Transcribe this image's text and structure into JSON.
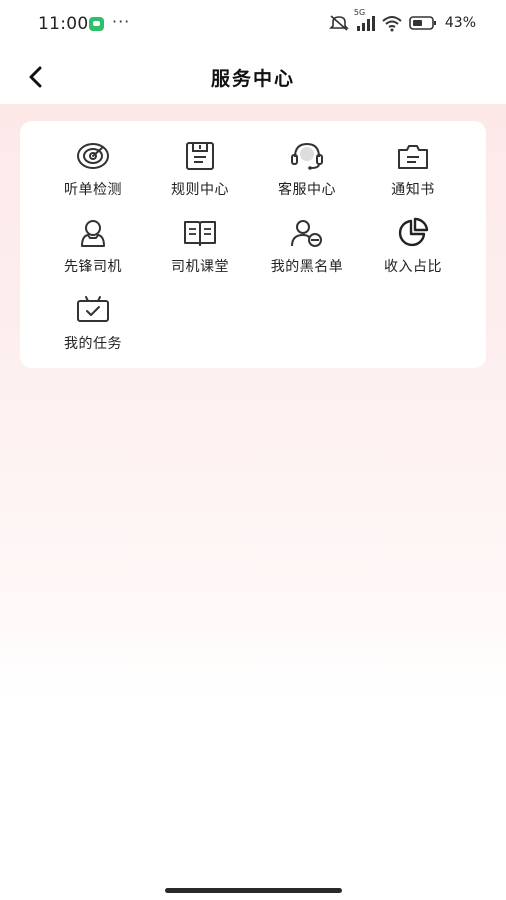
{
  "status_bar": {
    "time": "11:00",
    "more": "···",
    "network": "5G",
    "battery_pct": "43%"
  },
  "nav": {
    "title": "服务中心",
    "back_icon": "chevron-left-icon"
  },
  "services": [
    {
      "label": "听单检测",
      "icon": "radar-target-icon"
    },
    {
      "label": "规则中心",
      "icon": "save-document-icon"
    },
    {
      "label": "客服中心",
      "icon": "headset-icon"
    },
    {
      "label": "通知书",
      "icon": "notice-folder-icon"
    },
    {
      "label": "先锋司机",
      "icon": "driver-person-icon"
    },
    {
      "label": "司机课堂",
      "icon": "open-book-icon"
    },
    {
      "label": "我的黑名单",
      "icon": "blocked-user-icon"
    },
    {
      "label": "收入占比",
      "icon": "pie-chart-icon"
    },
    {
      "label": "我的任务",
      "icon": "task-tv-check-icon"
    }
  ],
  "colors": {
    "accent_bg": "#fde8e8",
    "icon_stroke": "#333333",
    "chat_badge": "#2fbf6b"
  }
}
